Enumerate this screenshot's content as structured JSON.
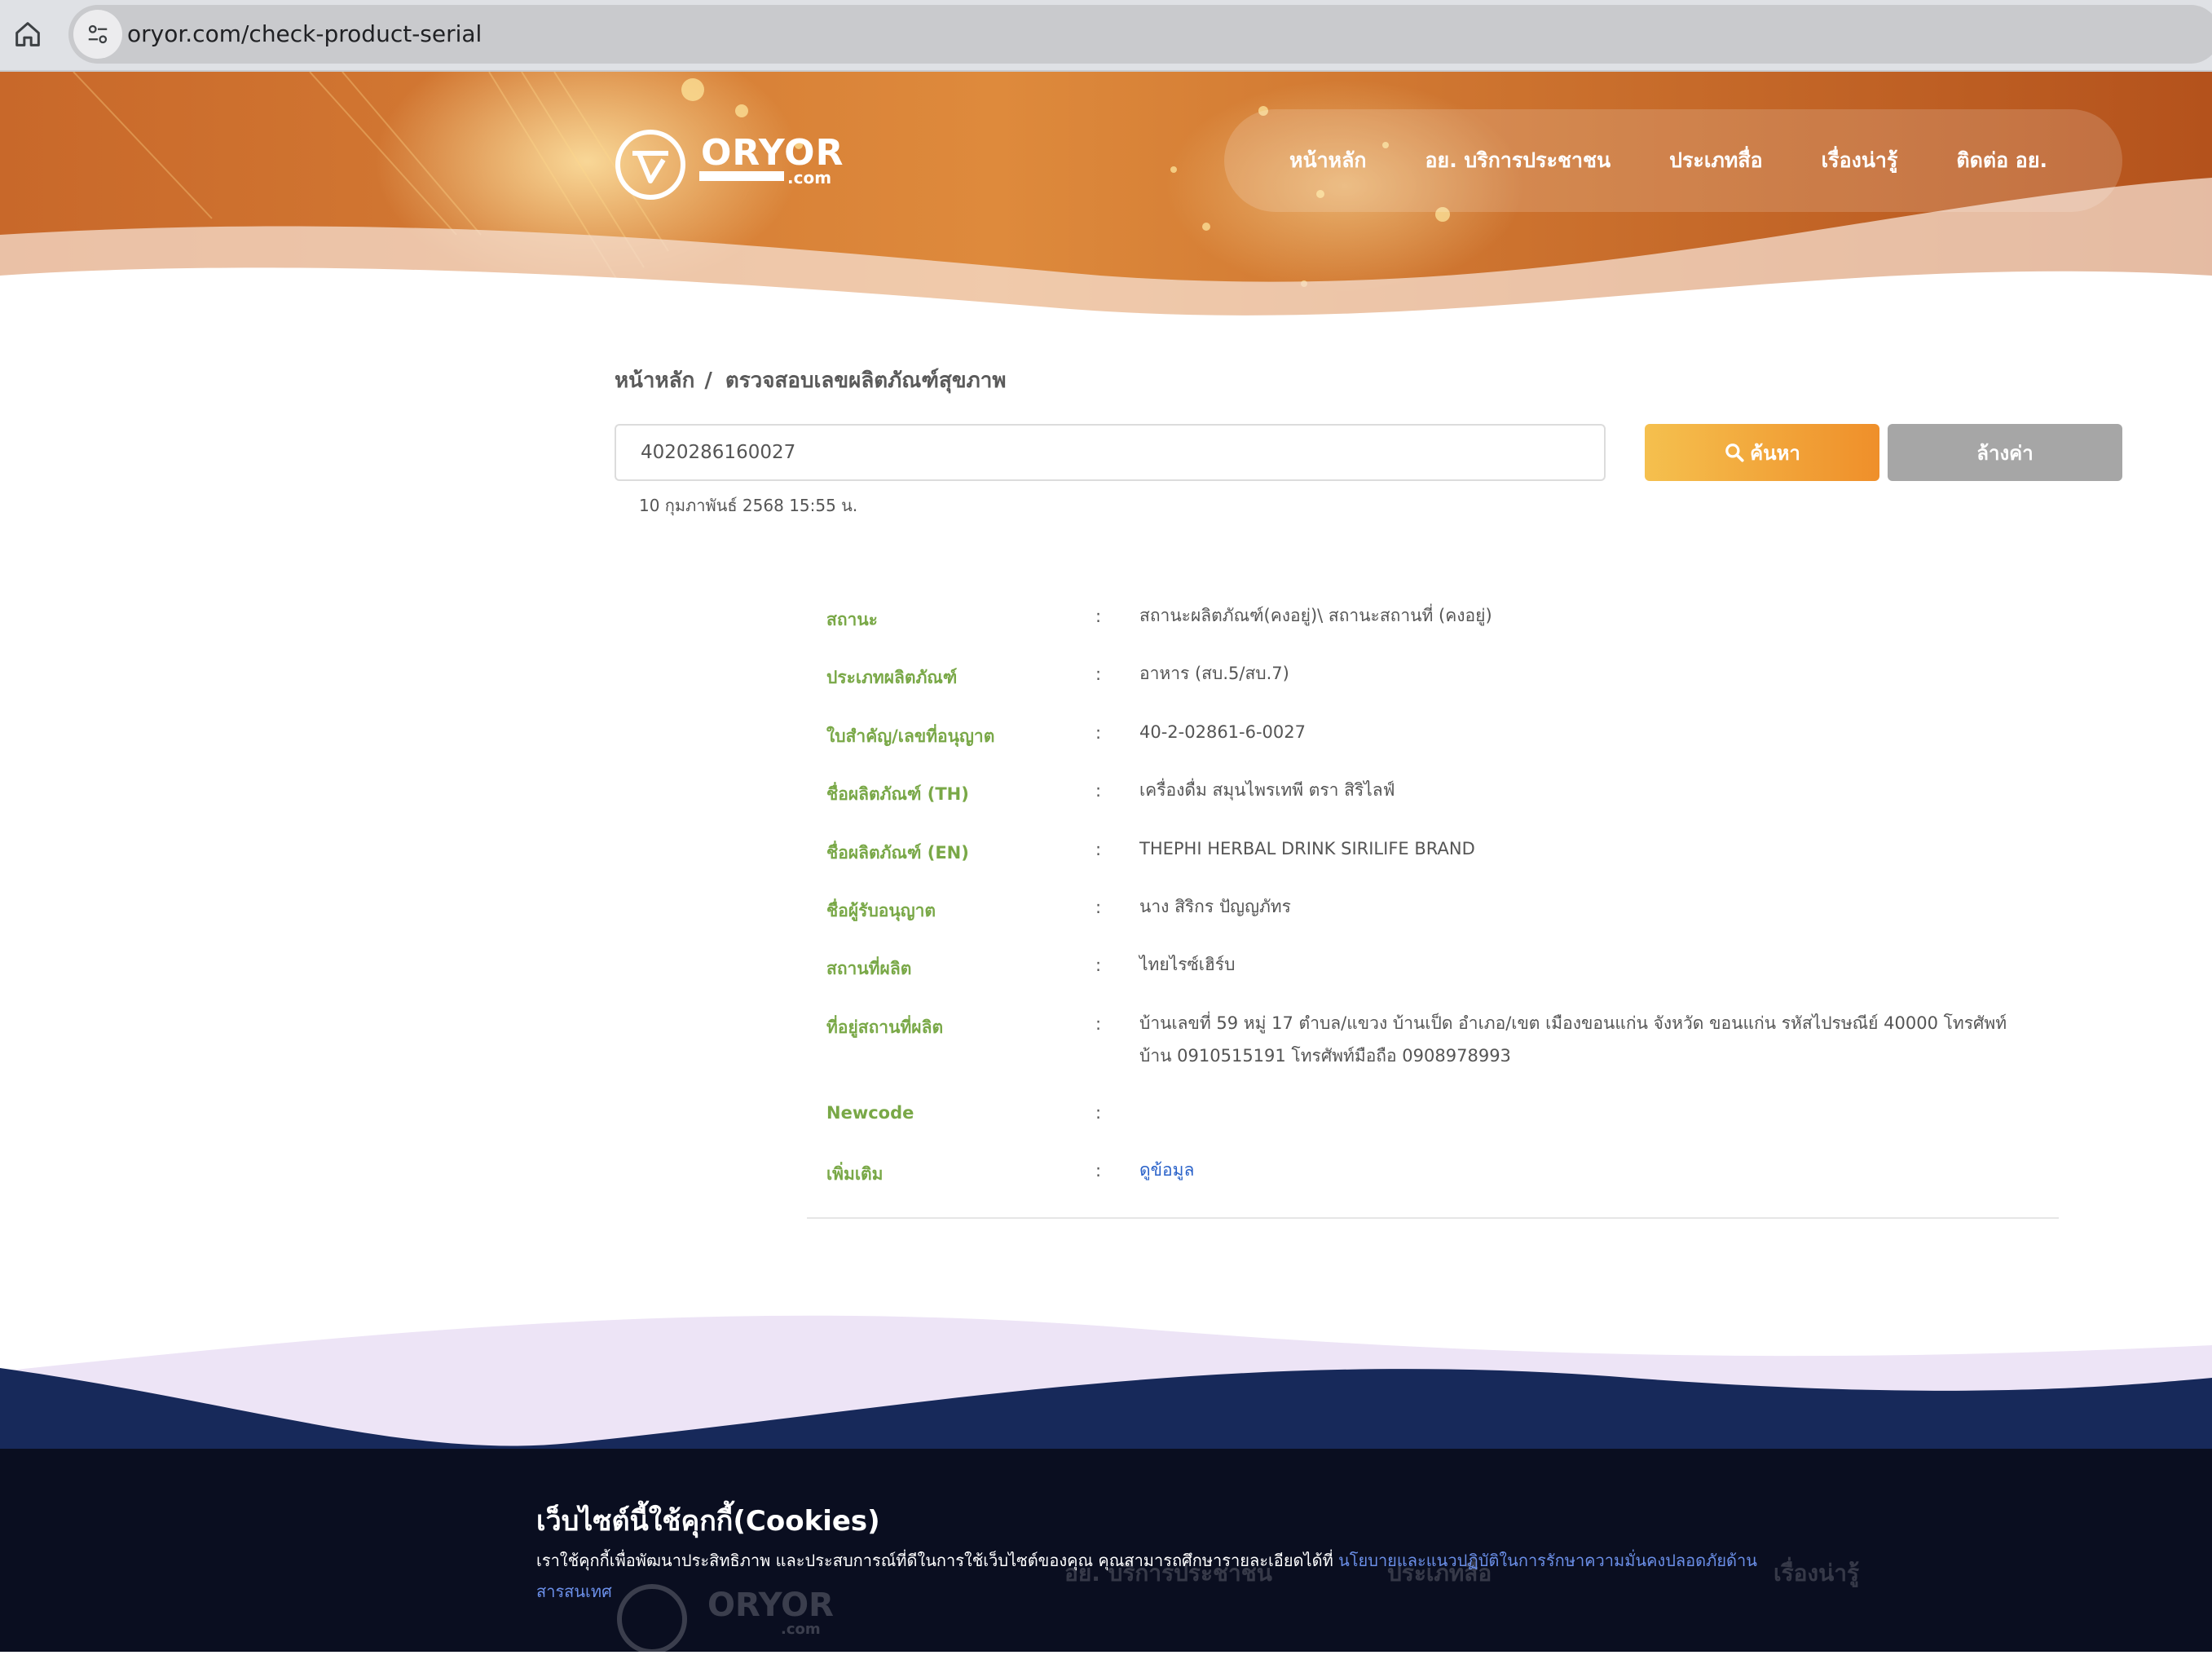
{
  "browser": {
    "url": "oryor.com/check-product-serial"
  },
  "header": {
    "logo_text": "ORYOR",
    "logo_sub": ".com",
    "nav": [
      "หน้าหลัก",
      "อย. บริการประชาชน",
      "ประเภทสื่อ",
      "เรื่องน่ารู้",
      "ติดต่อ อย."
    ]
  },
  "breadcrumb": {
    "home": "หน้าหลัก",
    "separator": "/",
    "current": "ตรวจสอบเลขผลิตภัณฑ์สุขภาพ"
  },
  "search": {
    "value": "4020286160027",
    "timestamp": "10 กุมภาพันธ์ 2568 15:55 น.",
    "search_label": "ค้นหา",
    "clear_label": "ล้างค่า"
  },
  "details": [
    {
      "label": "สถานะ",
      "value": "สถานะผลิตภัณฑ์(คงอยู่)\\ สถานะสถานที่ (คงอยู่)"
    },
    {
      "label": "ประเภทผลิตภัณฑ์",
      "value": "อาหาร (สบ.5/สบ.7)"
    },
    {
      "label": "ใบสำคัญ/เลขที่อนุญาต",
      "value": "40-2-02861-6-0027"
    },
    {
      "label": "ชื่อผลิตภัณฑ์ (TH)",
      "value": "เครื่องดื่ม สมุนไพรเทพี ตรา สิริไลฟ์"
    },
    {
      "label": "ชื่อผลิตภัณฑ์ (EN)",
      "value": "THEPHI HERBAL DRINK SIRILIFE BRAND"
    },
    {
      "label": "ชื่อผู้รับอนุญาต",
      "value": "นาง สิริกร ปัญญภัทร"
    },
    {
      "label": "สถานที่ผลิต",
      "value": "ไทยไรซ์เฮิร์บ"
    },
    {
      "label": "ที่อยู่สถานที่ผลิต",
      "value": "บ้านเลขที่ 59 หมู่ 17 ตำบล/แขวง บ้านเป็ด อำเภอ/เขต เมืองขอนแก่น จังหวัด ขอนแก่น รหัสไปรษณีย์ 40000 โทรศัพท์บ้าน 0910515191 โทรศัพท์มือถือ 0908978993"
    },
    {
      "label": "Newcode",
      "value": ""
    },
    {
      "label": "เพิ่มเติม",
      "value": "ดูข้อมูล"
    }
  ],
  "colon": ":",
  "cookie": {
    "title": "เว็บไซต์นี้ใช้คุกกี้(Cookies)",
    "text": "เราใช้คุกกี้เพื่อพัฒนาประสิทธิภาพ และประสบการณ์ที่ดีในการใช้เว็บไซต์ของคุณ คุณสามารถศึกษารายละเอียดได้ที่ ",
    "link": "นโยบายและแนวปฏิบัติในการรักษาความมั่นคงปลอดภัยด้านสารสนเทศ"
  },
  "footer": {
    "logo_text": "ORYOR",
    "logo_sub": ".com",
    "links": [
      "อย. บริการประชาชน",
      "ประเภทสื่อ",
      "เรื่องน่ารู้"
    ]
  },
  "colors": {
    "header_orange": "#d7772e",
    "label_green": "#79a847",
    "search_gradient_start": "#f5c04e",
    "search_gradient_end": "#ef8f2a",
    "clear_gray": "#a6a6a6",
    "link_blue": "#2a62c9",
    "footer_navy": "#17295a"
  }
}
